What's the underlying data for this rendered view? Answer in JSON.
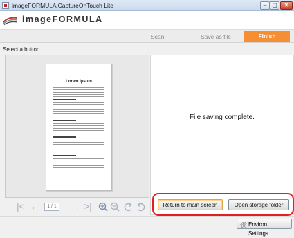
{
  "window": {
    "title": "imageFORMULA CaptureOnTouch Lite",
    "minimize": "–",
    "maximize": "▢",
    "close": "✕"
  },
  "header": {
    "logo_text": "imageFORMULA"
  },
  "steps": {
    "scan": "Scan",
    "save": "Save as file",
    "finish": "Finish",
    "arrow": "→"
  },
  "status": {
    "text": "Select a button."
  },
  "preview": {
    "doc_title": "Lorem ipsum",
    "nav": {
      "first": "|<",
      "prev": "←",
      "page": "1 / 1",
      "next": "→",
      "last": ">|"
    }
  },
  "result": {
    "message": "File saving complete."
  },
  "buttons": {
    "return_main": "Return to main screen",
    "open_folder": "Open storage folder",
    "environ_settings": "Environ. Settings"
  },
  "colors": {
    "accent": "#f68f33",
    "highlight": "#e02020"
  }
}
